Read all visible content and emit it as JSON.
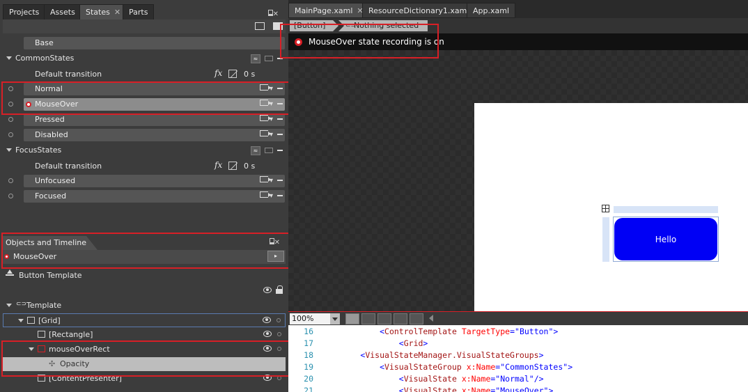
{
  "left_tabs": [
    {
      "label": "Projects",
      "active": false
    },
    {
      "label": "Assets",
      "active": false
    },
    {
      "label": "States",
      "active": true,
      "closable": true
    },
    {
      "label": "Parts",
      "active": false
    }
  ],
  "states": {
    "base_label": "Base",
    "groups": [
      {
        "name": "CommonStates",
        "default_transition_label": "Default transition",
        "fx_label": "fx",
        "duration": "0 s",
        "states": [
          {
            "label": "Normal",
            "selected": false,
            "recording": false
          },
          {
            "label": "MouseOver",
            "selected": true,
            "recording": true
          },
          {
            "label": "Pressed",
            "selected": false,
            "recording": false
          },
          {
            "label": "Disabled",
            "selected": false,
            "recording": false
          }
        ]
      },
      {
        "name": "FocusStates",
        "default_transition_label": "Default transition",
        "fx_label": "fx",
        "duration": "0 s",
        "states": [
          {
            "label": "Unfocused",
            "selected": false,
            "recording": false
          },
          {
            "label": "Focused",
            "selected": false,
            "recording": false
          }
        ]
      }
    ]
  },
  "objects_timeline": {
    "title": "Objects and Timeline",
    "storyboard": "MouseOver",
    "scope": "Button Template",
    "tree": [
      {
        "label": "Template",
        "level": 0
      },
      {
        "label": "[Grid]",
        "level": 1
      },
      {
        "label": "[Rectangle]",
        "level": 2
      },
      {
        "label": "mouseOverRect",
        "level": 2
      },
      {
        "label": "Opacity",
        "level": 3
      },
      {
        "label": "[ContentPresenter]",
        "level": 2
      }
    ]
  },
  "doc_tabs": [
    {
      "label": "MainPage.xaml",
      "active": true,
      "closable": true
    },
    {
      "label": "ResourceDictionary1.xaml",
      "active": false
    },
    {
      "label": "App.xaml",
      "active": false
    }
  ],
  "breadcrumb": [
    "[Button]",
    "Nothing selected"
  ],
  "recording_message": "MouseOver state recording is on",
  "artboard": {
    "button_text": "Hello",
    "button_color": "#0000F5"
  },
  "zoom": "100%",
  "code_lines": [
    {
      "n": "16",
      "indent": "            ",
      "tag": "ControlTemplate",
      "attr": "TargetType",
      "val": "Button",
      "close": ">"
    },
    {
      "n": "17",
      "indent": "                ",
      "tag": "Grid",
      "attr": "",
      "val": "",
      "close": ">"
    },
    {
      "n": "18",
      "indent": "        ",
      "tag": "VisualStateManager.VisualStateGroups",
      "attr": "",
      "val": "",
      "close": ">"
    },
    {
      "n": "19",
      "indent": "            ",
      "tag": "VisualStateGroup",
      "attr": "x:Name",
      "val": "CommonStates",
      "close": ">"
    },
    {
      "n": "20",
      "indent": "                ",
      "tag": "VisualState",
      "attr": "x:Name",
      "val": "Normal",
      "close": "/>"
    },
    {
      "n": "21",
      "indent": "                ",
      "tag": "VisualState",
      "attr": "x:Name",
      "val": "MouseOver",
      "close": ">"
    }
  ],
  "colors": {
    "highlight": "#D81F26",
    "recording": "#D81F26"
  }
}
